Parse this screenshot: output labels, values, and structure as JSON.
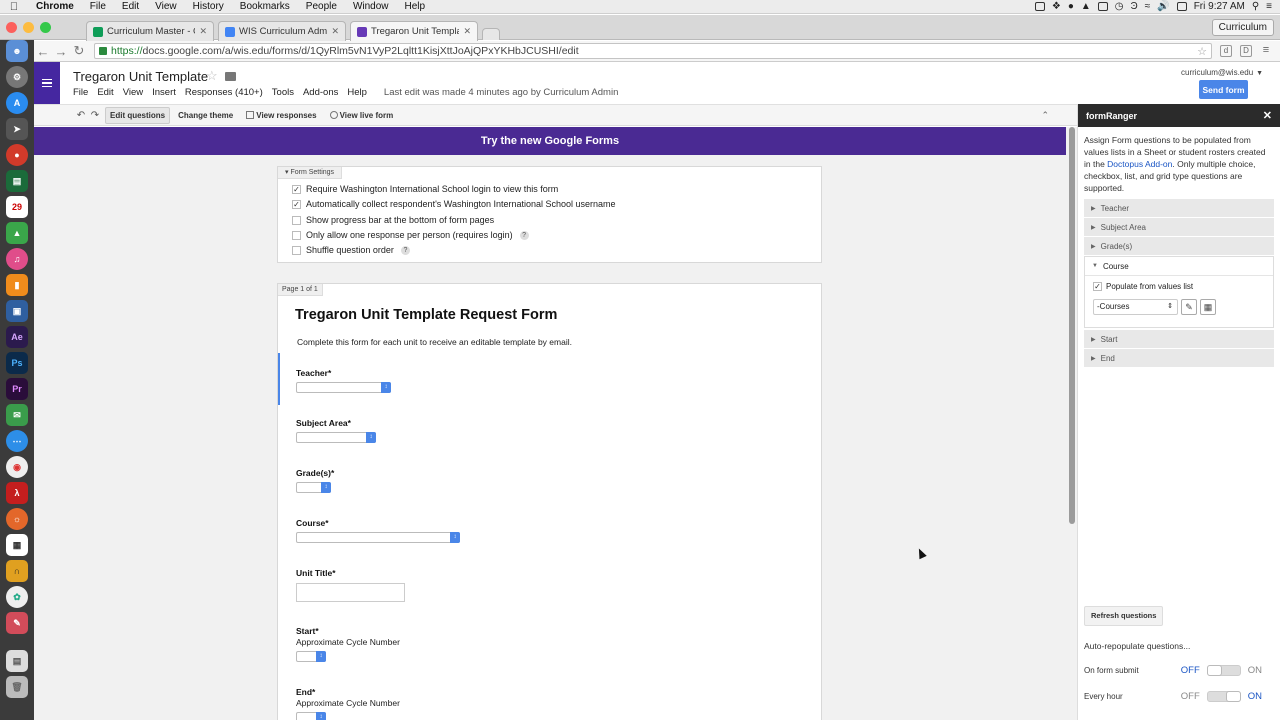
{
  "menubar": {
    "app": "Chrome",
    "items": [
      "File",
      "Edit",
      "View",
      "History",
      "Bookmarks",
      "People",
      "Window",
      "Help"
    ],
    "clock": "Fri 9:27 AM"
  },
  "browser": {
    "tabs": [
      {
        "title": "Curriculum Master - Google",
        "color": "#0f9d58"
      },
      {
        "title": "WIS Curriculum Admin - Go",
        "color": "#4285f4"
      },
      {
        "title": "Tregaron Unit Template - G",
        "color": "#673ab7"
      }
    ],
    "profile": "Curriculum",
    "url_scheme": "https://",
    "url_rest": "docs.google.com/a/wis.edu/forms/d/1QyRlm5vN1VyP2Lqltt1KisjXttJoAjQPxYKHbJCUSHI/edit"
  },
  "doc": {
    "title": "Tregaron Unit Template",
    "menu": [
      "File",
      "Edit",
      "View",
      "Insert",
      "Responses (410+)",
      "Tools",
      "Add-ons",
      "Help"
    ],
    "last_edit": "Last edit was made 4 minutes ago by Curriculum Admin",
    "account": "curriculum@wis.edu",
    "send_form": "Send form"
  },
  "toolbar": {
    "edit_questions": "Edit questions",
    "change_theme": "Change theme",
    "view_responses": "View responses",
    "view_live_form": "View live form"
  },
  "banner": "Try the new Google Forms",
  "settings": {
    "header": "Form Settings",
    "options": [
      {
        "label": "Require Washington International School login to view this form",
        "checked": true
      },
      {
        "label": "Automatically collect respondent's Washington International School username",
        "checked": true
      },
      {
        "label": "Show progress bar at the bottom of form pages",
        "checked": false
      },
      {
        "label": "Only allow one response per person (requires login)",
        "checked": false
      },
      {
        "label": "Shuffle question order",
        "checked": false
      }
    ]
  },
  "form": {
    "page_label": "Page 1 of 1",
    "title": "Tregaron Unit Template Request Form",
    "description": "Complete this form for each unit to receive an editable template by email.",
    "questions": [
      {
        "label": "Teacher*"
      },
      {
        "label": "Subject Area*"
      },
      {
        "label": "Grade(s)*"
      },
      {
        "label": "Course*"
      },
      {
        "label": "Unit Title*"
      },
      {
        "label": "Start*",
        "help": "Approximate Cycle Number"
      },
      {
        "label": "End*",
        "help": "Approximate Cycle Number"
      }
    ]
  },
  "panel": {
    "title": "formRanger",
    "desc_a": "Assign Form questions to be populated from values lists in a Sheet or student rosters created in the ",
    "desc_link": "Doctopus Add-on",
    "desc_b": ". Only multiple choice, checkbox, list, and grid type questions are supported.",
    "sections_before": [
      "Teacher",
      "Subject Area",
      "Grade(s)"
    ],
    "open_section": "Course",
    "populate_label": "Populate from values list",
    "values_list": "-Courses",
    "sections_after": [
      "Start",
      "End"
    ],
    "refresh": "Refresh questions",
    "auto": "Auto-repopulate questions...",
    "toggles": [
      {
        "label": "On form submit",
        "off": "OFF",
        "on": "ON",
        "state": "off"
      },
      {
        "label": "Every hour",
        "off": "OFF",
        "on": "ON",
        "state": "on"
      }
    ],
    "colors": {
      "off_active": "#1a55c4",
      "inactive": "#888"
    }
  }
}
